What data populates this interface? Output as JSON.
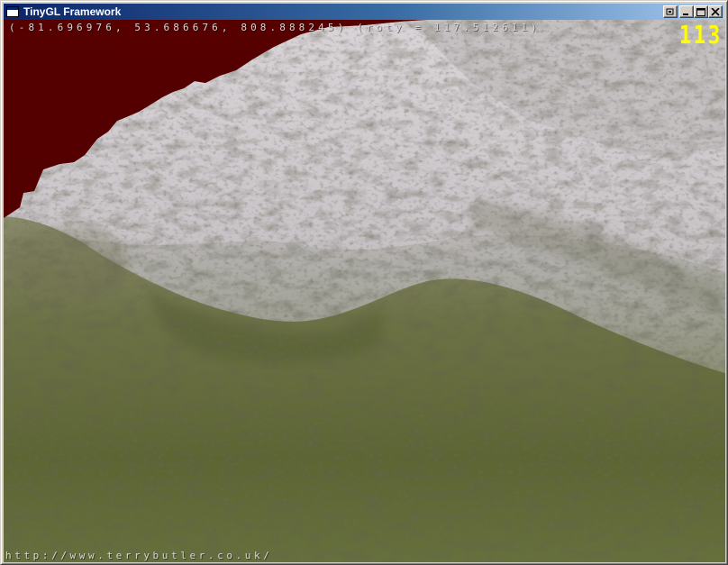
{
  "window": {
    "title": "TinyGL Framework",
    "controls": {
      "restore_icon": "restore-icon",
      "minimize_icon": "minimize-icon",
      "maximize_icon": "maximize-icon",
      "close_icon": "close-icon"
    }
  },
  "hud": {
    "coords": "(-81.696976, 53.686676, 808.888245) (roty = 117.512611)",
    "fps": "113",
    "url": "http://www.terrybutler.co.uk/"
  },
  "colors": {
    "sky": "#530000",
    "fps_text": "#ffff00",
    "hud_text": "#d8d8d8",
    "titlebar_start": "#0a246a",
    "titlebar_end": "#a6caf0"
  }
}
